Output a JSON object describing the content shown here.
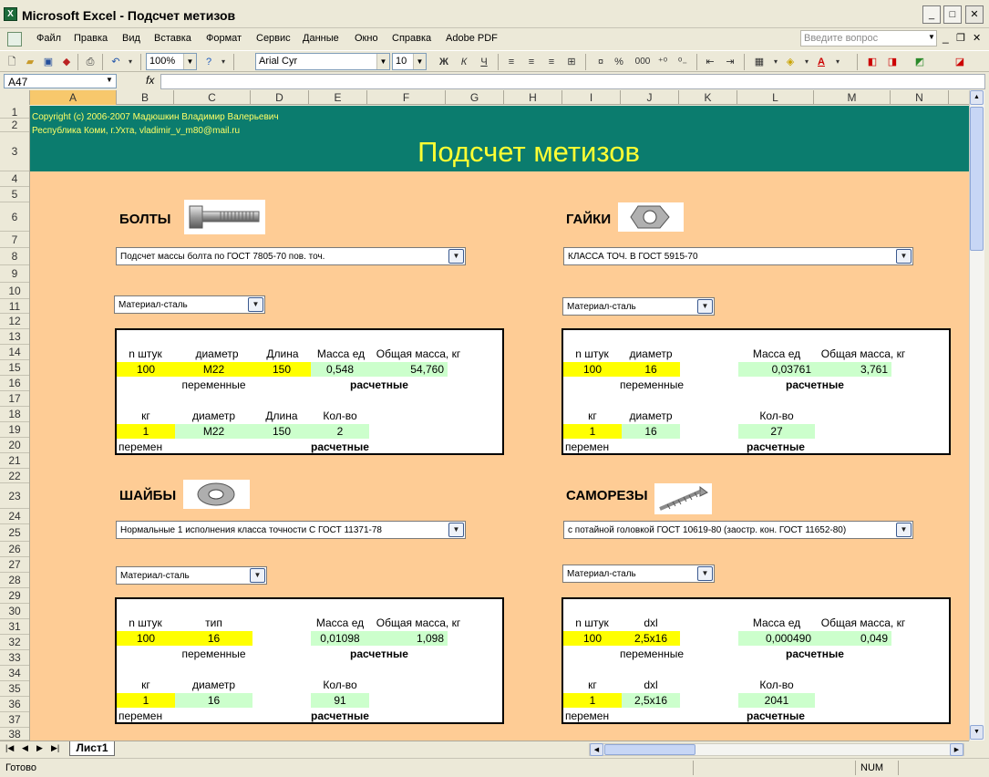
{
  "window": {
    "app_icon": "X",
    "title": "Microsoft Excel - Подсчет метизов",
    "buttons": {
      "minimize": "_",
      "maximize": "□",
      "close": "✕"
    }
  },
  "menubar": {
    "items": [
      "Файл",
      "Правка",
      "Вид",
      "Вставка",
      "Формат",
      "Сервис",
      "Данные",
      "Окно",
      "Справка",
      "Adobe PDF"
    ],
    "question_placeholder": "Введите вопрос"
  },
  "toolbar": {
    "zoom": "100%",
    "font_name": "Arial Cyr",
    "font_size": "10",
    "bold": "Ж",
    "italic": "К",
    "underline": "Ч",
    "percent": "%",
    "thousands": "000"
  },
  "formula_bar": {
    "name_box": "A47",
    "fx": "fx",
    "content": ""
  },
  "columns": [
    "A",
    "B",
    "C",
    "D",
    "E",
    "F",
    "G",
    "H",
    "I",
    "J",
    "K",
    "L",
    "M",
    "N"
  ],
  "selected_column": "A",
  "rows": [
    "1",
    "2",
    "3",
    "4",
    "5",
    "6",
    "7",
    "8",
    "9",
    "10",
    "11",
    "12",
    "13",
    "14",
    "15",
    "16",
    "17",
    "18",
    "19",
    "20",
    "21",
    "22",
    "23",
    "24",
    "25",
    "26",
    "27",
    "28",
    "29",
    "30",
    "31",
    "32",
    "33",
    "34",
    "35",
    "36",
    "37",
    "38"
  ],
  "sheet": {
    "copyright_line1": "Copyright (c) 2006-2007 Мадюшкин Владимир Валерьевич",
    "copyright_line2": "Республика Коми, г.Ухта,  vladimir_v_m80@mail.ru",
    "title": "Подсчет метизов"
  },
  "sections": {
    "bolts": {
      "title": "БОЛТЫ",
      "icon": "bolt-image",
      "standard": "Подсчет массы болта по ГОСТ 7805-70 пов. точ.",
      "material": "Материал-сталь",
      "top_headers": [
        "n штук",
        "диаметр",
        "Длина",
        "Масса ед",
        "Общая масса, кг"
      ],
      "top_values": [
        "100",
        "M22",
        "150",
        "0,548",
        "54,760"
      ],
      "label_variable": "переменные",
      "label_calculated": "расчетные",
      "bottom_headers": [
        "кг",
        "диаметр",
        "Длина",
        "Кол-во"
      ],
      "bottom_values": [
        "1",
        "M22",
        "150",
        "2"
      ],
      "label_variable_short": "перемен",
      "label_calculated_bottom": "расчетные"
    },
    "nuts": {
      "title": "ГАЙКИ",
      "icon": "nut-image",
      "standard": "КЛАССА ТОЧ. В ГОСТ 5915-70",
      "material": "Материал-сталь",
      "top_headers": [
        "n штук",
        "диаметр",
        "Масса ед",
        "Общая масса, кг"
      ],
      "top_values": [
        "100",
        "16",
        "0,03761",
        "3,761"
      ],
      "label_variable": "переменные",
      "label_calculated": "расчетные",
      "bottom_headers": [
        "кг",
        "диаметр",
        "Кол-во"
      ],
      "bottom_values": [
        "1",
        "16",
        "27"
      ],
      "label_variable_short": "перемен",
      "label_calculated_bottom": "расчетные"
    },
    "washers": {
      "title": "ШАЙБЫ",
      "icon": "washer-image",
      "standard": "Нормальные 1 исполнения класса точности С ГОСТ 11371-78",
      "material": "Материал-сталь",
      "top_headers": [
        "n штук",
        "тип",
        "Масса ед",
        "Общая масса, кг"
      ],
      "top_values": [
        "100",
        "16",
        "0,01098",
        "1,098"
      ],
      "label_variable": "переменные",
      "label_calculated": "расчетные",
      "bottom_headers": [
        "кг",
        "диаметр",
        "Кол-во"
      ],
      "bottom_values": [
        "1",
        "16",
        "91"
      ],
      "label_variable_short": "перемен",
      "label_calculated_bottom": "расчетные"
    },
    "screws": {
      "title": "САМОРЕЗЫ",
      "icon": "screw-image",
      "standard": "с потайной головкой ГОСТ 10619-80 (заостр. кон. ГОСТ 11652-80)",
      "material": "Материал-сталь",
      "top_headers": [
        "n штук",
        "dxl",
        "Масса ед",
        "Общая масса, кг"
      ],
      "top_values": [
        "100",
        "2,5x16",
        "0,000490",
        "0,049"
      ],
      "label_variable": "переменные",
      "label_calculated": "расчетные",
      "bottom_headers": [
        "кг",
        "dxl",
        "Кол-во"
      ],
      "bottom_values": [
        "1",
        "2,5x16",
        "2041"
      ],
      "label_variable_short": "перемен",
      "label_calculated_bottom": "расчетные"
    }
  },
  "sheet_tab": "Лист1",
  "statusbar": {
    "status": "Готово",
    "num": "NUM"
  },
  "colors": {
    "banner": "#0b7c6e",
    "sheet_bg": "#fecc95",
    "input": "#ffff00",
    "result": "#ccffcc",
    "banner_text": "#ffff33"
  }
}
